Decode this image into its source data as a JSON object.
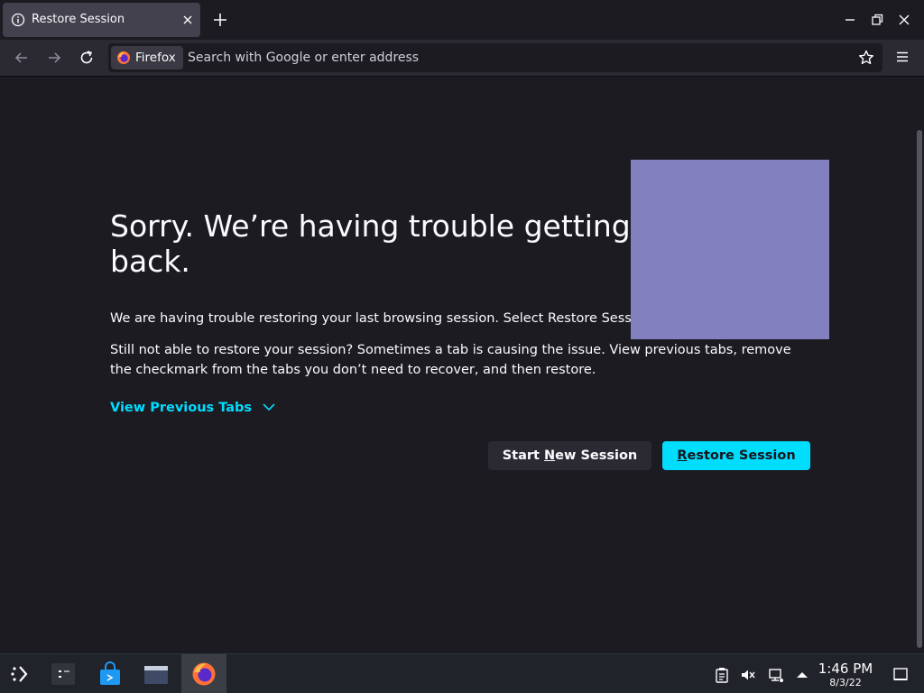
{
  "tab": {
    "title": "Restore Session"
  },
  "urlbar": {
    "identity_label": "Firefox",
    "placeholder": "Search with Google or enter address"
  },
  "page": {
    "heading_line1": "Sorry. We’re having trouble getting yo",
    "heading_line2": "back.",
    "paragraph1": "We are having trouble restoring your last browsing session. Select Restore Session",
    "paragraph2": "Still not able to restore your session? Sometimes a tab is causing the issue. View previous tabs, remove the checkmark from the tabs you don’t need to recover, and then restore.",
    "view_previous_tabs": "View Previous Tabs",
    "start_new_session": {
      "before": "Start ",
      "accel": "N",
      "after": "ew Session"
    },
    "restore_session": {
      "accel": "R",
      "after": "estore Session"
    }
  },
  "taskbar": {
    "time": "1:46 PM",
    "date": "8/3/22"
  },
  "colors": {
    "accent": "#00ddff",
    "background": "#1c1b22",
    "toolbar": "#2b2a33",
    "redaction": "#8380c0"
  }
}
